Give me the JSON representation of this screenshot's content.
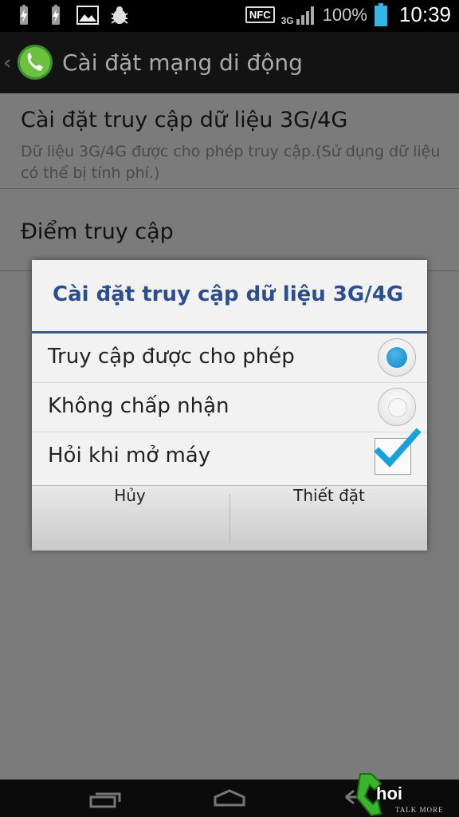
{
  "status_bar": {
    "icons_left": [
      "battery-charging-icon",
      "battery-charging-icon",
      "image-icon",
      "bug-icon"
    ],
    "nfc": "NFC",
    "network": "3G",
    "battery_percent": "100%",
    "time": "10:39"
  },
  "action_bar": {
    "title": "Cài đặt mạng di động",
    "icon": "phone-icon"
  },
  "list": {
    "items": [
      {
        "title": "Cài đặt truy cập dữ liệu 3G/4G",
        "subtitle": "Dữ liệu 3G/4G được cho phép truy cập.(Sử dụng dữ liệu có thể bị tính phí.)"
      },
      {
        "title": "Điểm truy cập"
      }
    ]
  },
  "dialog": {
    "title": "Cài đặt truy cập dữ liệu 3G/4G",
    "options": [
      {
        "label": "Truy cập được cho phép",
        "control": "radio",
        "checked": true
      },
      {
        "label": "Không chấp nhận",
        "control": "radio",
        "checked": false
      },
      {
        "label": "Hỏi khi mở máy",
        "control": "checkbox",
        "checked": true
      }
    ],
    "cancel_label": "Hủy",
    "ok_label": "Thiết đặt"
  },
  "watermark": {
    "brand": "hoi",
    "tagline": "TALK MORE"
  },
  "colors": {
    "accent": "#2b4e8f",
    "radio_on": "#0d86c2",
    "check": "#1aa0d8"
  }
}
